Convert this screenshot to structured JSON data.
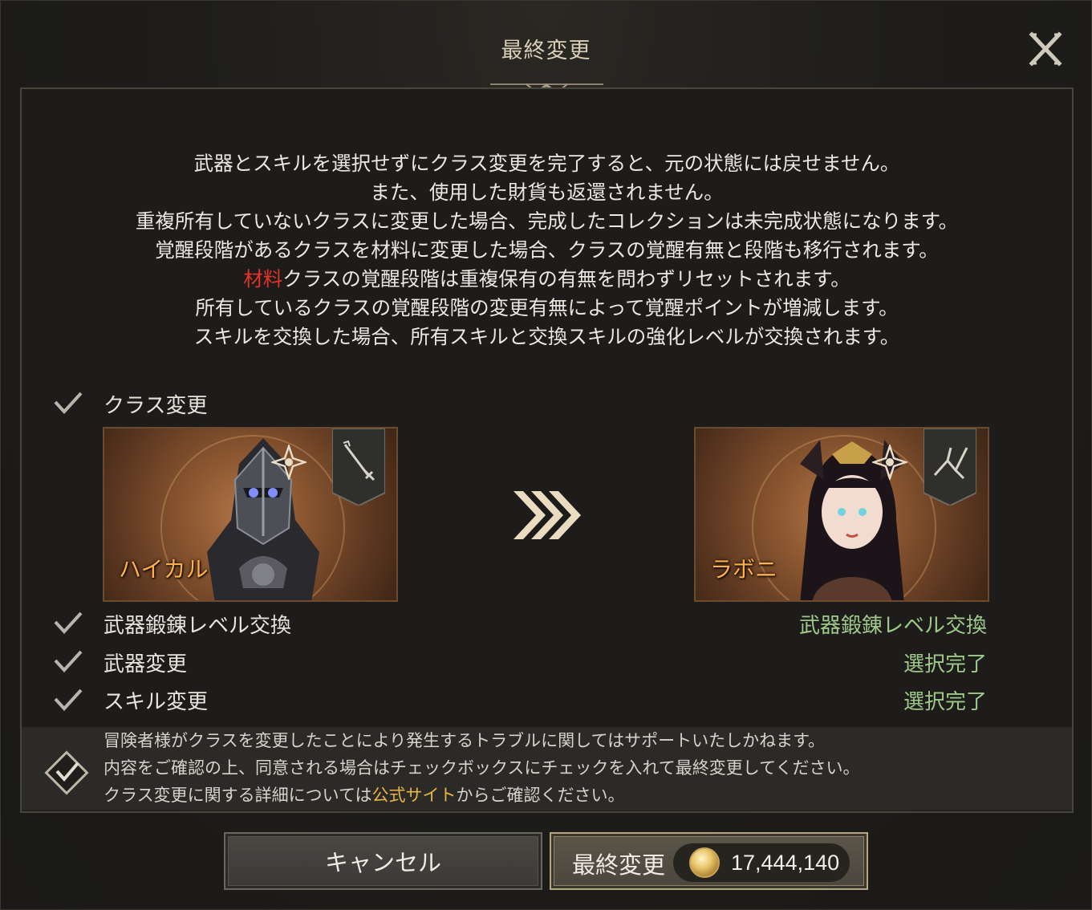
{
  "dialog": {
    "title": "最終変更",
    "close_label": "X"
  },
  "notice": {
    "line1": "武器とスキルを選択せずにクラス変更を完了すると、元の状態には戻せません。",
    "line2": "また、使用した財貨も返還されません。",
    "line3": "重複所有していないクラスに変更した場合、完成したコレクションは未完成状態になります。",
    "line4": "覚醒段階があるクラスを材料に変更した場合、クラスの覚醒有無と段階も移行されます。",
    "line5_highlight": "材料",
    "line5_rest": "クラスの覚醒段階は重複保有の有無を問わずリセットされます。",
    "line6": "所有しているクラスの覚醒段階の変更有無によって覚醒ポイントが増減します。",
    "line7": "スキルを交換した場合、所有スキルと交換スキルの強化レベルが交換されます。"
  },
  "class_change": {
    "label": "クラス変更",
    "from": {
      "name": "ハイカル",
      "weapon_icon": "sword-icon"
    },
    "to": {
      "name": "ラボニ",
      "weapon_icon": "claw-icon"
    }
  },
  "rows": [
    {
      "label": "武器鍛錬レベル交換",
      "value": "武器鍛錬レベル交換"
    },
    {
      "label": "武器変更",
      "value": "選択完了"
    },
    {
      "label": "スキル変更",
      "value": "選択完了"
    }
  ],
  "consent": {
    "line1": "冒険者様がクラスを変更したことにより発生するトラブルに関してはサポートいたしかねます。",
    "line2": "内容をご確認の上、同意される場合はチェックボックスにチェックを入れて最終変更してください。",
    "line3_before": "クラス変更に関する詳細については",
    "line3_link": "公式サイト",
    "line3_after": "からご確認ください。"
  },
  "buttons": {
    "cancel": "キャンセル",
    "confirm": "最終変更",
    "cost": "17,444,140"
  },
  "colors": {
    "accent_green": "#9fc98a",
    "highlight_red": "#e5332a",
    "link_gold": "#e8b548",
    "name_orange": "#ffb04a"
  }
}
